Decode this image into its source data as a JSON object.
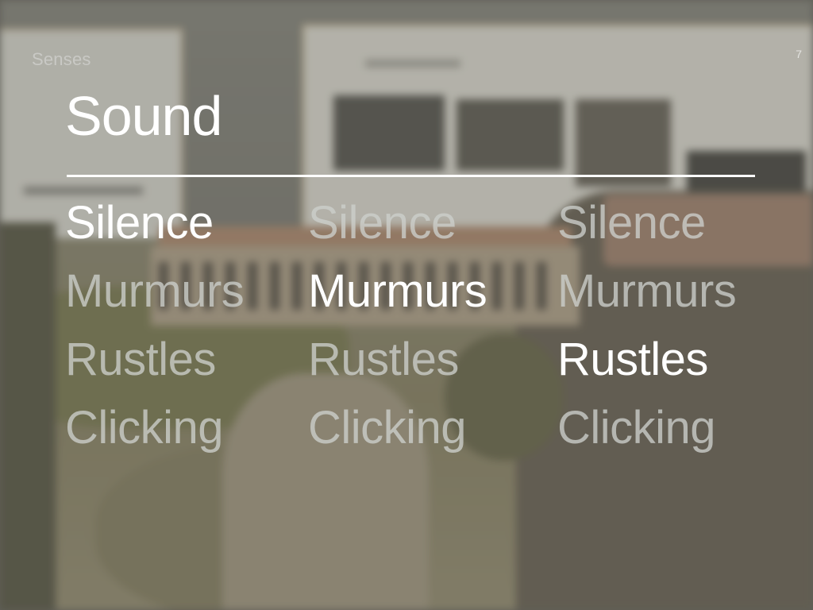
{
  "slide": {
    "eyebrow": "Senses",
    "page_number": "7",
    "title": "Sound"
  },
  "grid": {
    "rows": [
      {
        "words": [
          "Silence",
          "Silence",
          "Silence"
        ],
        "active_column": 1
      },
      {
        "words": [
          "Murmurs",
          "Murmurs",
          "Murmurs"
        ],
        "active_column": 2
      },
      {
        "words": [
          "Rustles",
          "Rustles",
          "Rustles"
        ],
        "active_column": 3
      },
      {
        "words": [
          "Clicking",
          "Clicking",
          "Clicking"
        ],
        "active_column": null
      }
    ]
  },
  "colors": {
    "active_text": "#ffffff",
    "inactive_text": "#c9cbc8",
    "rule": "#ffffff"
  }
}
